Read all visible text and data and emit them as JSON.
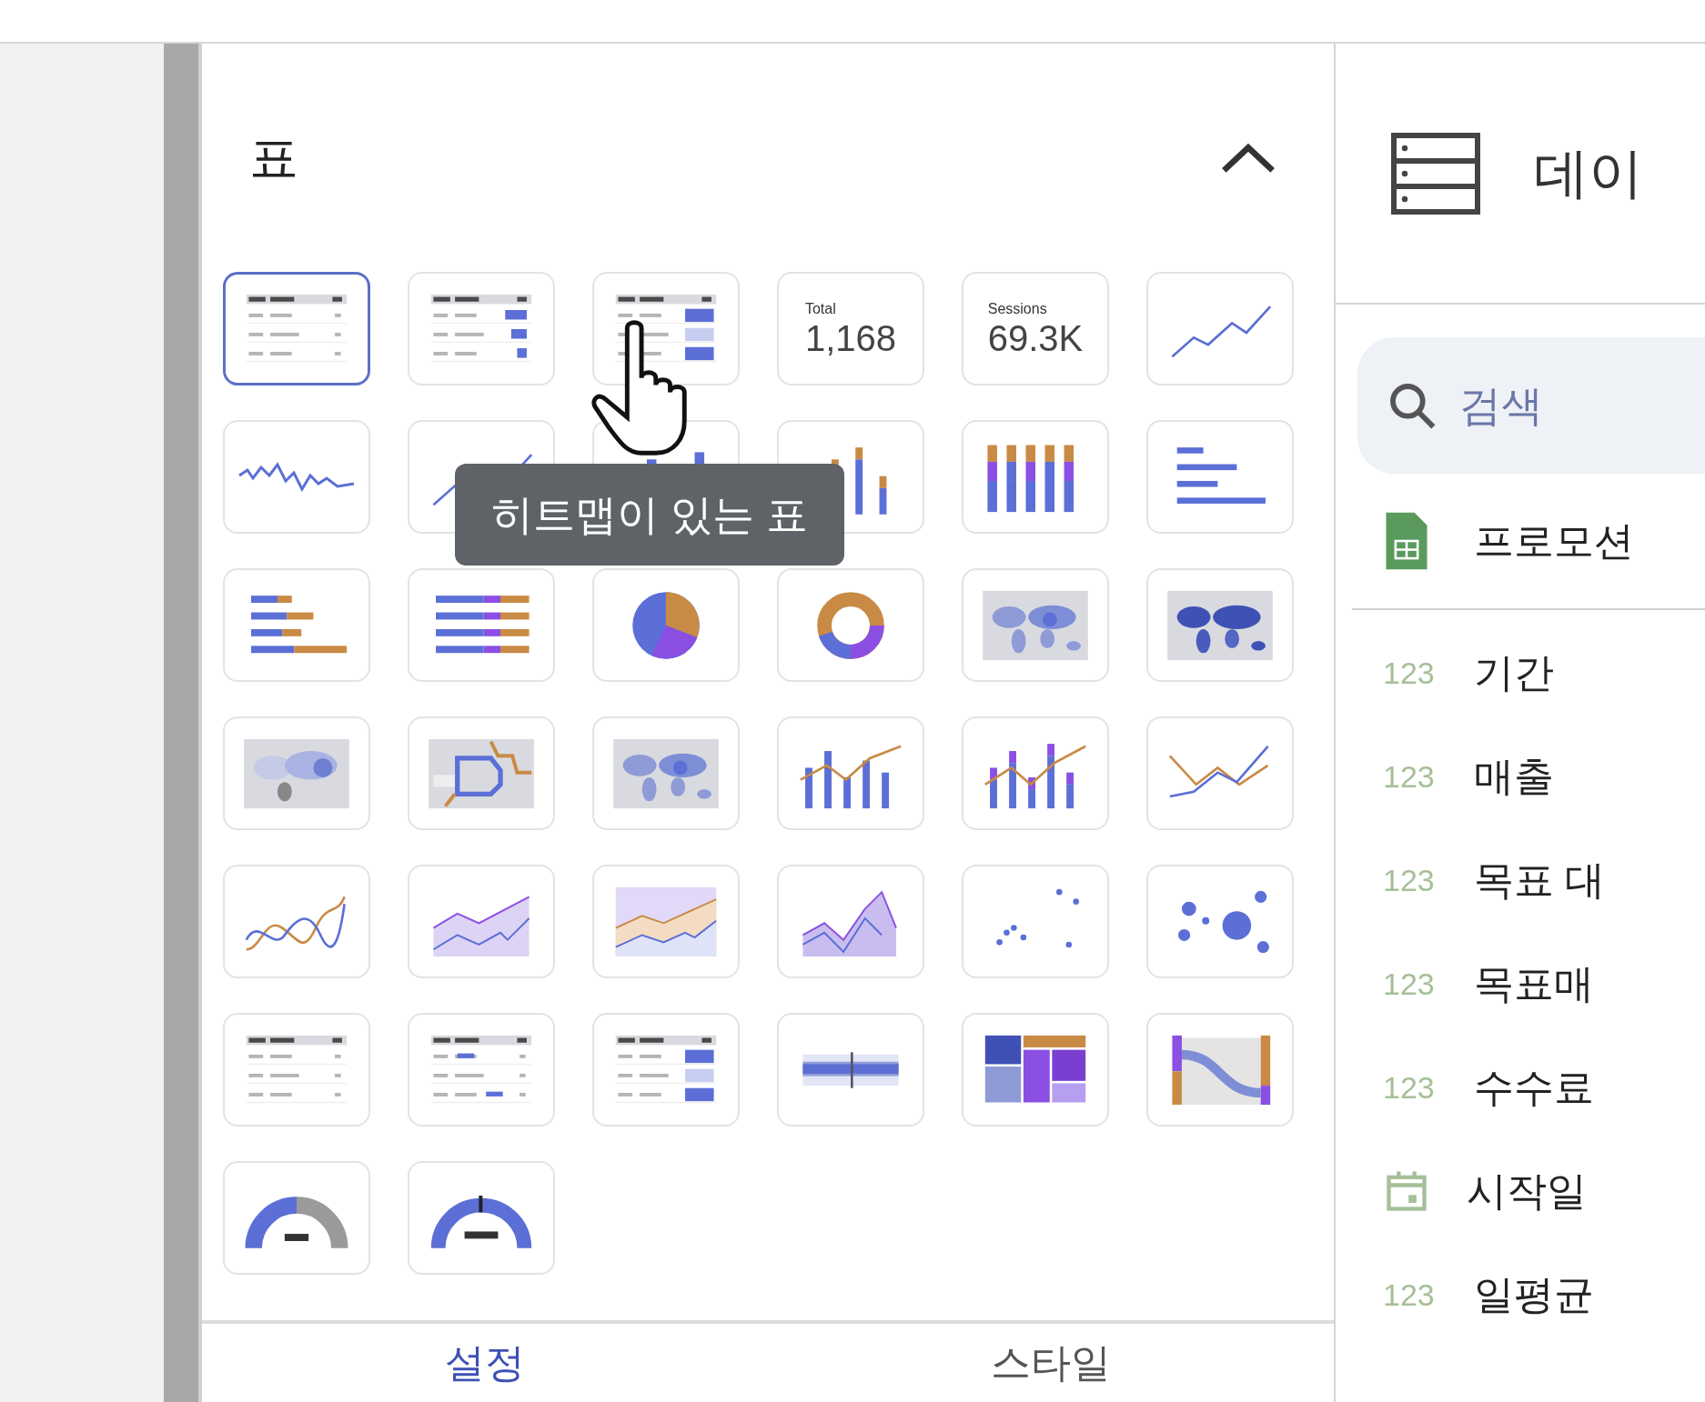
{
  "chart_panel": {
    "title": "표",
    "tiles": [
      {
        "kind": "table",
        "selected": true
      },
      {
        "kind": "table-bars",
        "selected": false
      },
      {
        "kind": "table-heatmap",
        "selected": false
      },
      {
        "kind": "scorecard",
        "selected": false,
        "label": "Total",
        "value": "1,168"
      },
      {
        "kind": "scorecard",
        "selected": false,
        "label": "Sessions",
        "value": "69.3K"
      },
      {
        "kind": "line",
        "selected": false
      },
      {
        "kind": "sparkline",
        "selected": false
      },
      {
        "kind": "line",
        "selected": false
      },
      {
        "kind": "column",
        "selected": false
      },
      {
        "kind": "stacked-column",
        "selected": false
      },
      {
        "kind": "full-column",
        "selected": false
      },
      {
        "kind": "hbar",
        "selected": false
      },
      {
        "kind": "stacked-hbar",
        "selected": false
      },
      {
        "kind": "full-hbar",
        "selected": false
      },
      {
        "kind": "pie",
        "selected": false
      },
      {
        "kind": "donut",
        "selected": false
      },
      {
        "kind": "map",
        "selected": false
      },
      {
        "kind": "filled-map",
        "selected": false
      },
      {
        "kind": "bubble-map",
        "selected": false
      },
      {
        "kind": "route-map",
        "selected": false
      },
      {
        "kind": "map",
        "selected": false
      },
      {
        "kind": "combo",
        "selected": false
      },
      {
        "kind": "stacked-combo",
        "selected": false
      },
      {
        "kind": "multi-line",
        "selected": false
      },
      {
        "kind": "smooth-line",
        "selected": false
      },
      {
        "kind": "area",
        "selected": false
      },
      {
        "kind": "stacked-area",
        "selected": false
      },
      {
        "kind": "overlap-area",
        "selected": false
      },
      {
        "kind": "scatter",
        "selected": false
      },
      {
        "kind": "bubble",
        "selected": false
      },
      {
        "kind": "pivot",
        "selected": false
      },
      {
        "kind": "pivot-bars",
        "selected": false
      },
      {
        "kind": "pivot-heatmap",
        "selected": false
      },
      {
        "kind": "bullet",
        "selected": false
      },
      {
        "kind": "treemap",
        "selected": false
      },
      {
        "kind": "sankey",
        "selected": false
      },
      {
        "kind": "gauge",
        "selected": false
      },
      {
        "kind": "progress-gauge",
        "selected": false
      }
    ],
    "tooltip": "히트맵이 있는 표",
    "tabs": [
      {
        "label": "설정",
        "selected": true
      },
      {
        "label": "스타일",
        "selected": false
      }
    ]
  },
  "data_panel": {
    "title": "데이",
    "search": {
      "placeholder": "검색"
    },
    "source": "프로모션",
    "fields": [
      {
        "kind": "number",
        "type_label": "123",
        "name": "기간"
      },
      {
        "kind": "number",
        "type_label": "123",
        "name": "매출"
      },
      {
        "kind": "number",
        "type_label": "123",
        "name": "목표 대"
      },
      {
        "kind": "number",
        "type_label": "123",
        "name": "목표매"
      },
      {
        "kind": "number",
        "type_label": "123",
        "name": "수수료"
      },
      {
        "kind": "date",
        "name": "시작일"
      },
      {
        "kind": "number",
        "type_label": "123",
        "name": "일평균"
      }
    ]
  }
}
